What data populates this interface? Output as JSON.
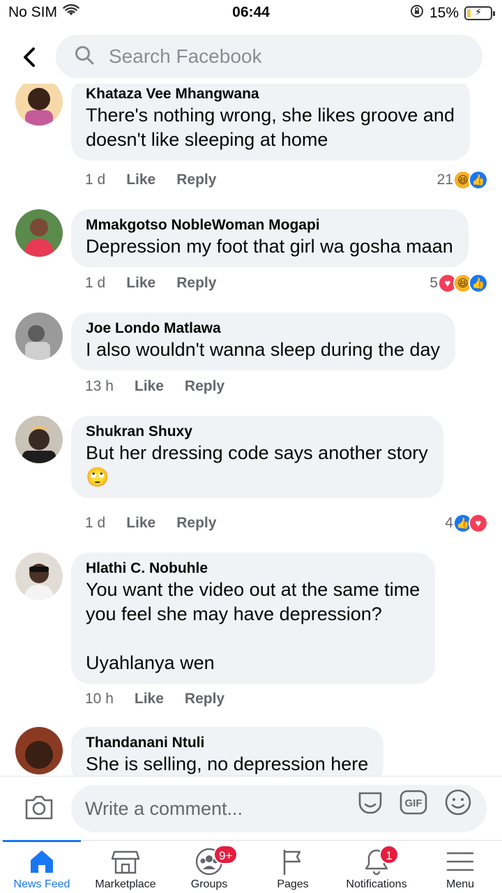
{
  "status_bar": {
    "carrier": "No SIM",
    "time": "06:44",
    "battery_text": "15%",
    "battery_level": 0.15
  },
  "header": {
    "search_placeholder": "Search Facebook"
  },
  "comments": [
    {
      "author": "Khataza Vee Mhangwana",
      "text": "There's nothing wrong, she likes groove and\ndoesn't like sleeping at home",
      "time": "1 d",
      "like_label": "Like",
      "reply_label": "Reply",
      "reaction_count": "21",
      "reactions": [
        "haha",
        "like"
      ],
      "avatar_color": "#f7d9a8"
    },
    {
      "author": "Mmakgotso NobleWoman Mogapi",
      "text": "Depression my foot that girl wa gosha maan",
      "time": "1 d",
      "like_label": "Like",
      "reply_label": "Reply",
      "reaction_count": "5",
      "reactions": [
        "love",
        "haha",
        "like"
      ],
      "avatar_color": "#5b8a4d"
    },
    {
      "author": "Joe Londo Matlawa",
      "text": "I also wouldn't wanna sleep during the day",
      "time": "13 h",
      "like_label": "Like",
      "reply_label": "Reply",
      "reaction_count": "",
      "reactions": [],
      "avatar_color": "#9a9a9a"
    },
    {
      "author": "Shukran Shuxy",
      "text": "But her dressing code says another story\n🙄",
      "time": "1 d",
      "like_label": "Like",
      "reply_label": "Reply",
      "reaction_count": "4",
      "reactions": [
        "like",
        "love"
      ],
      "avatar_color": "#c9c3b8"
    },
    {
      "author": "Hlathi C. Nobuhle",
      "text": "You want the video out at the same time\nyou feel she may have depression?\n\nUyahlanya wen",
      "time": "10 h",
      "like_label": "Like",
      "reply_label": "Reply",
      "reaction_count": "",
      "reactions": [],
      "avatar_color": "#e2dcd6"
    },
    {
      "author": "Thandanani Ntuli",
      "text": "She is selling, no depression here",
      "time": "",
      "like_label": "",
      "reply_label": "",
      "reaction_count": "",
      "reactions": [],
      "avatar_color": "#8a3a22"
    }
  ],
  "composer": {
    "placeholder": "Write a comment...",
    "gif_label": "GIF"
  },
  "nav": [
    {
      "label": "News Feed",
      "icon": "home-icon",
      "badge": "",
      "active": true
    },
    {
      "label": "Marketplace",
      "icon": "marketplace-icon",
      "badge": "",
      "active": false
    },
    {
      "label": "Groups",
      "icon": "groups-icon",
      "badge": "9+",
      "active": false
    },
    {
      "label": "Pages",
      "icon": "pages-flag-icon",
      "badge": "",
      "active": false
    },
    {
      "label": "Notifications",
      "icon": "bell-icon",
      "badge": "1",
      "active": false
    },
    {
      "label": "Menu",
      "icon": "hamburger-icon",
      "badge": "",
      "active": false
    }
  ],
  "colors": {
    "accent": "#1877f2",
    "bubble": "#f0f2f5",
    "badge": "#e41e3f",
    "meta_text": "#65676b"
  }
}
